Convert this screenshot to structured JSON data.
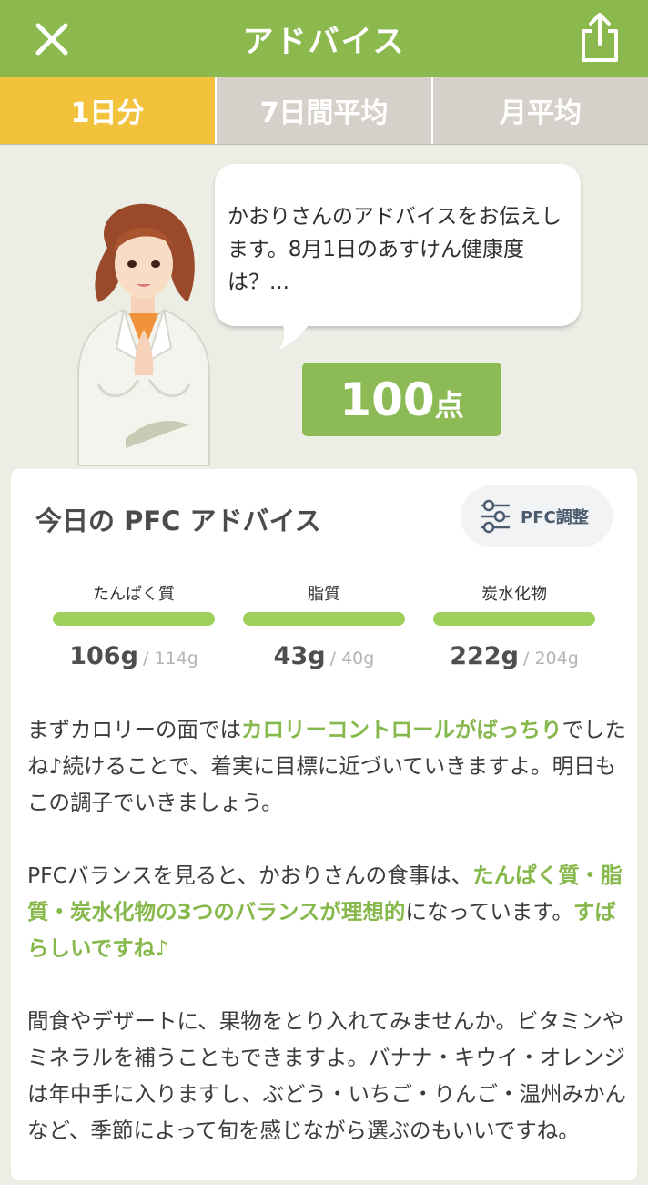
{
  "header": {
    "title": "アドバイス"
  },
  "tabs": [
    {
      "label": "1日分",
      "active": true
    },
    {
      "label": "7日間平均",
      "active": false
    },
    {
      "label": "月平均",
      "active": false
    }
  ],
  "advisor": {
    "message": "かおりさんのアドバイスをお伝えします。8月1日のあすけん健康度は？...",
    "score_value": "100",
    "score_unit": "点"
  },
  "pfc": {
    "title": "今日の PFC アドバイス",
    "adjust_label": "PFC調整",
    "nutrients": [
      {
        "label": "たんぱく質",
        "actual": "106g",
        "target": "/ 114g"
      },
      {
        "label": "脂質",
        "actual": "43g",
        "target": "/ 40g"
      },
      {
        "label": "炭水化物",
        "actual": "222g",
        "target": "/ 204g"
      }
    ]
  },
  "advice": {
    "p1": [
      "まずカロリーの面では",
      "カロリーコントロールがばっちり",
      "でしたね♪続けることで、着実に目標に近づいていきますよ。明日もこの調子でいきましょう。"
    ],
    "p2": [
      "PFCバランスを見ると、かおりさんの食事は、",
      "たんぱく質・脂質・炭水化物の3つのバランスが理想的",
      "になっています。",
      "すばらしいですね♪"
    ],
    "p3": "間食やデザートに、果物をとり入れてみませんか。ビタミンやミネラルを補うこともできますよ。バナナ・キウイ・オレンジは年中手に入りますし、ぶどう・いちご・りんご・温州みかんなど、季節によって旬を感じながら選ぶのもいいですね。"
  },
  "colors": {
    "header": "#8cb94e",
    "tab_active": "#f2c23c",
    "tab_inactive": "#d5d1ca",
    "score": "#8cbb55",
    "bar": "#9fcf5c",
    "highlight": "#86b84c"
  },
  "icons": {
    "close": "close-icon",
    "share": "share-icon",
    "adjust": "sliders-icon"
  }
}
